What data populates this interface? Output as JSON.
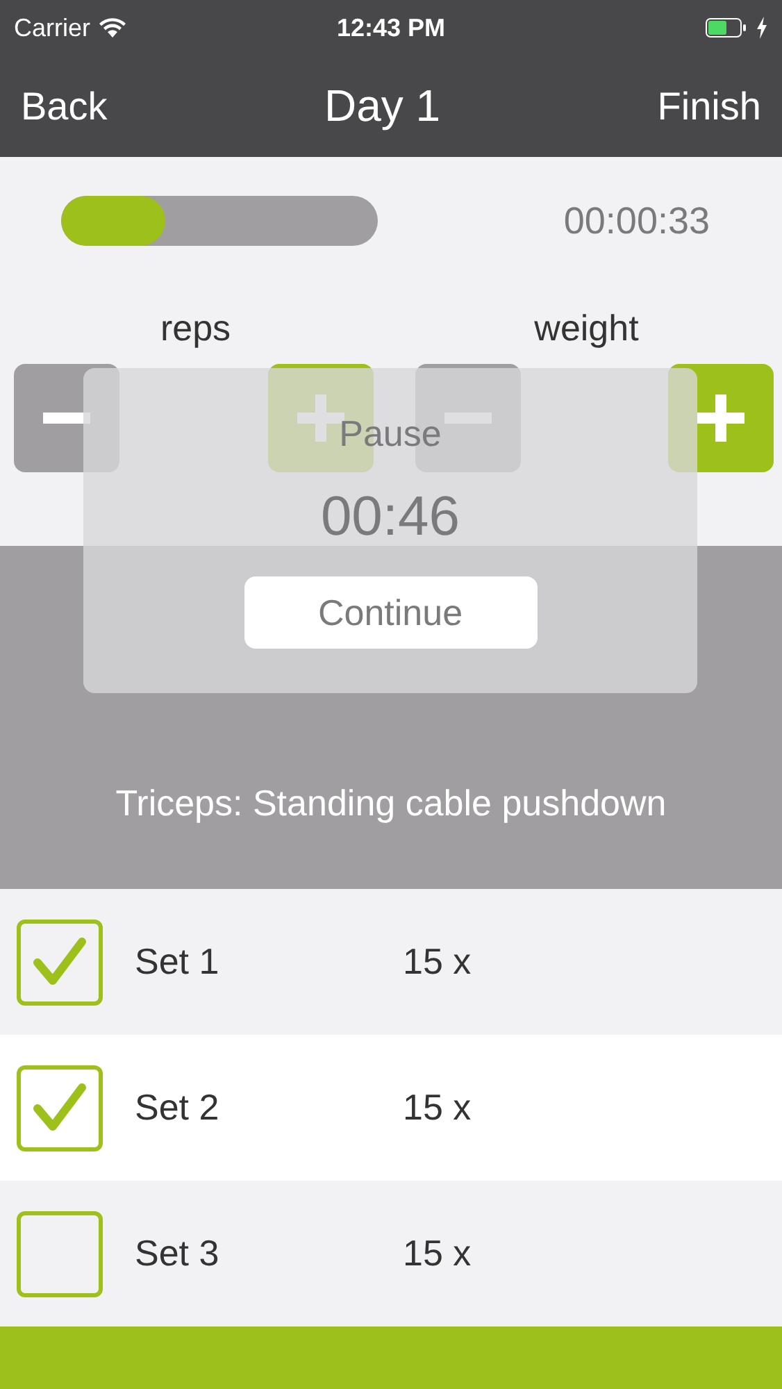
{
  "status_bar": {
    "carrier": "Carrier",
    "time": "12:43 PM",
    "charging": true
  },
  "nav": {
    "back": "Back",
    "title": "Day 1",
    "finish": "Finish"
  },
  "progress": {
    "level": 0.33,
    "elapsed": "00:00:33"
  },
  "steppers": [
    {
      "label": "reps"
    },
    {
      "label": "weight"
    }
  ],
  "exercise": "Triceps: Standing cable pushdown",
  "sets": [
    {
      "name": "Set 1",
      "reps": "15 x",
      "checked": true
    },
    {
      "name": "Set 2",
      "reps": "15 x",
      "checked": true
    },
    {
      "name": "Set 3",
      "reps": "15 x",
      "checked": false
    }
  ],
  "pause_dialog": {
    "title": "Pause",
    "countdown": "00:46",
    "button": "Continue"
  }
}
